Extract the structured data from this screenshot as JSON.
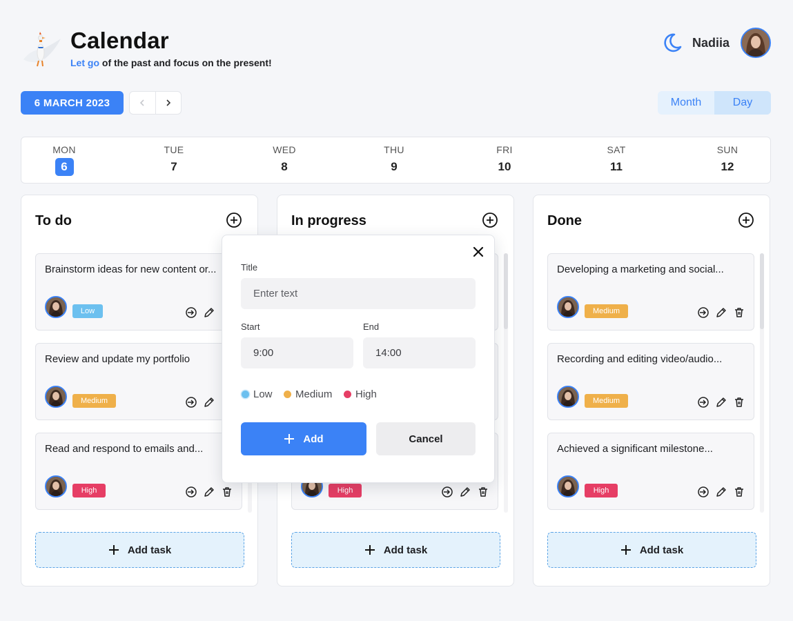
{
  "header": {
    "app_title": "Calendar",
    "tagline_accent": "Let go",
    "tagline_rest": " of the past and focus on the present!",
    "user_name": "Nadiia",
    "theme_icon": "moon-icon",
    "logo_icon": "bird-logo-icon"
  },
  "toolbar": {
    "date_label": "6 MARCH 2023",
    "prev_icon": "chevron-left-icon",
    "next_icon": "chevron-right-icon",
    "views": [
      "Month",
      "Day"
    ],
    "active_view": "Day"
  },
  "week": {
    "selected": "6",
    "days": [
      {
        "name": "MON",
        "num": "6"
      },
      {
        "name": "TUE",
        "num": "7"
      },
      {
        "name": "WED",
        "num": "8"
      },
      {
        "name": "THU",
        "num": "9"
      },
      {
        "name": "FRI",
        "num": "10"
      },
      {
        "name": "SAT",
        "num": "11"
      },
      {
        "name": "SUN",
        "num": "12"
      }
    ]
  },
  "columns": [
    {
      "title": "To do",
      "add_task_label": "Add task",
      "cards": [
        {
          "title": "Brainstorm ideas for new content or...",
          "priority": "Low",
          "level": "low"
        },
        {
          "title": "Review and update my portfolio",
          "priority": "Medium",
          "level": "medium"
        },
        {
          "title": "Read and respond to emails and...",
          "priority": "High",
          "level": "high"
        }
      ]
    },
    {
      "title": "In progress",
      "add_task_label": "Add task",
      "cards": [
        {
          "title": "",
          "priority": "",
          "level": "none"
        },
        {
          "title": "",
          "priority": "",
          "level": "none"
        },
        {
          "title": "",
          "priority": "High",
          "level": "high"
        }
      ]
    },
    {
      "title": "Done",
      "add_task_label": "Add task",
      "cards": [
        {
          "title": "Developing a marketing and social...",
          "priority": "Medium",
          "level": "medium"
        },
        {
          "title": "Recording and editing video/audio...",
          "priority": "Medium",
          "level": "medium"
        },
        {
          "title": "Achieved a significant milestone...",
          "priority": "High",
          "level": "high"
        }
      ]
    }
  ],
  "modal": {
    "title_label": "Title",
    "title_placeholder": "Enter text",
    "start_label": "Start",
    "start_value": "9:00",
    "end_label": "End",
    "end_value": "14:00",
    "priorities": [
      {
        "label": "Low",
        "color": "#6cc0ef"
      },
      {
        "label": "Medium",
        "color": "#efb04a"
      },
      {
        "label": "High",
        "color": "#e63e65"
      }
    ],
    "add_label": "Add",
    "cancel_label": "Cancel"
  },
  "colors": {
    "accent": "#3b82f6",
    "low": "#6cc0ef",
    "medium": "#efb04a",
    "high": "#e63e65"
  }
}
